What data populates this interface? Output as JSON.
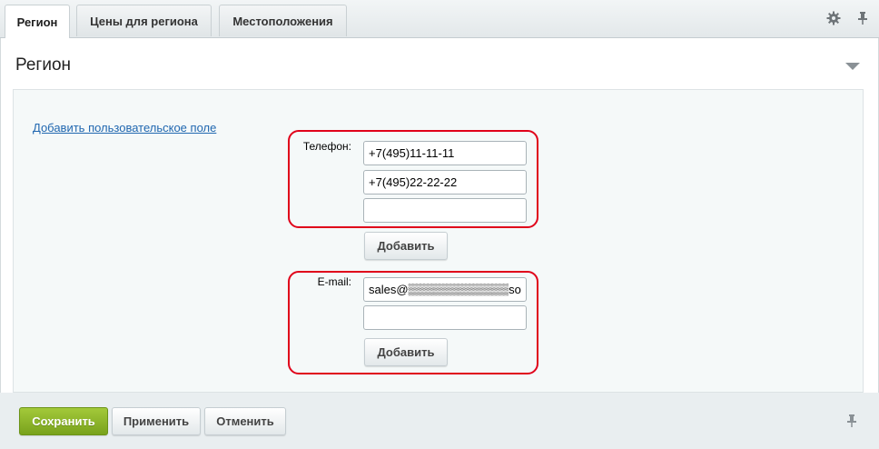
{
  "tabs": [
    {
      "label": "Регион",
      "active": true
    },
    {
      "label": "Цены для региона",
      "active": false
    },
    {
      "label": "Местоположения",
      "active": false
    }
  ],
  "toolbar": {
    "settings_icon": "gear-icon",
    "pin_icon": "pin-icon"
  },
  "panel": {
    "title": "Регион",
    "collapse_icon": "triangle-down-icon"
  },
  "form": {
    "add_field_link": "Добавить пользовательское поле",
    "phone": {
      "label": "Телефон:",
      "values": [
        "+7(495)11-11-11",
        "+7(495)22-22-22",
        ""
      ],
      "add_button": "Добавить"
    },
    "email": {
      "label": "E-mail:",
      "values": [
        "sales@▒▒▒▒▒▒▒▒▒▒▒▒sott",
        ""
      ],
      "add_button": "Добавить"
    }
  },
  "footer": {
    "save": "Сохранить",
    "apply": "Применить",
    "cancel": "Отменить",
    "pin_icon": "pin-icon"
  },
  "colors": {
    "accent_green": "#8cb22b",
    "highlight_red": "#e0001a",
    "link_blue": "#2067b0"
  }
}
